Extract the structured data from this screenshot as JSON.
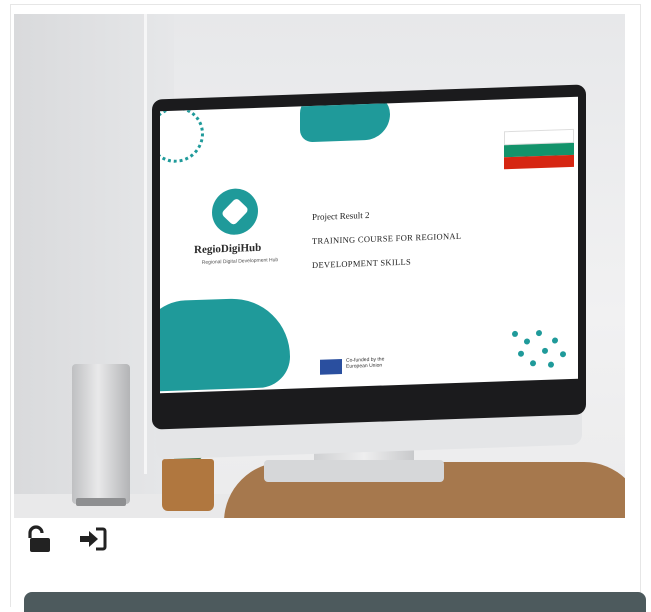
{
  "card": {
    "image": {
      "project_result": "Project Result 2",
      "course_line1": "TRAINING COURSE FOR REGIONAL",
      "course_line2": "DEVELOPMENT SKILLS",
      "logo_text": "RegioDigiHub",
      "logo_subtitle": "Regional Digital Development Hub",
      "eu_text": "Co-funded by the European Union"
    },
    "icons": [
      "unlock-icon",
      "sign-in-icon"
    ]
  },
  "colors": {
    "teal": "#1f9a9a",
    "bottom_bar": "#4d5a5d",
    "icon": "#222222"
  }
}
